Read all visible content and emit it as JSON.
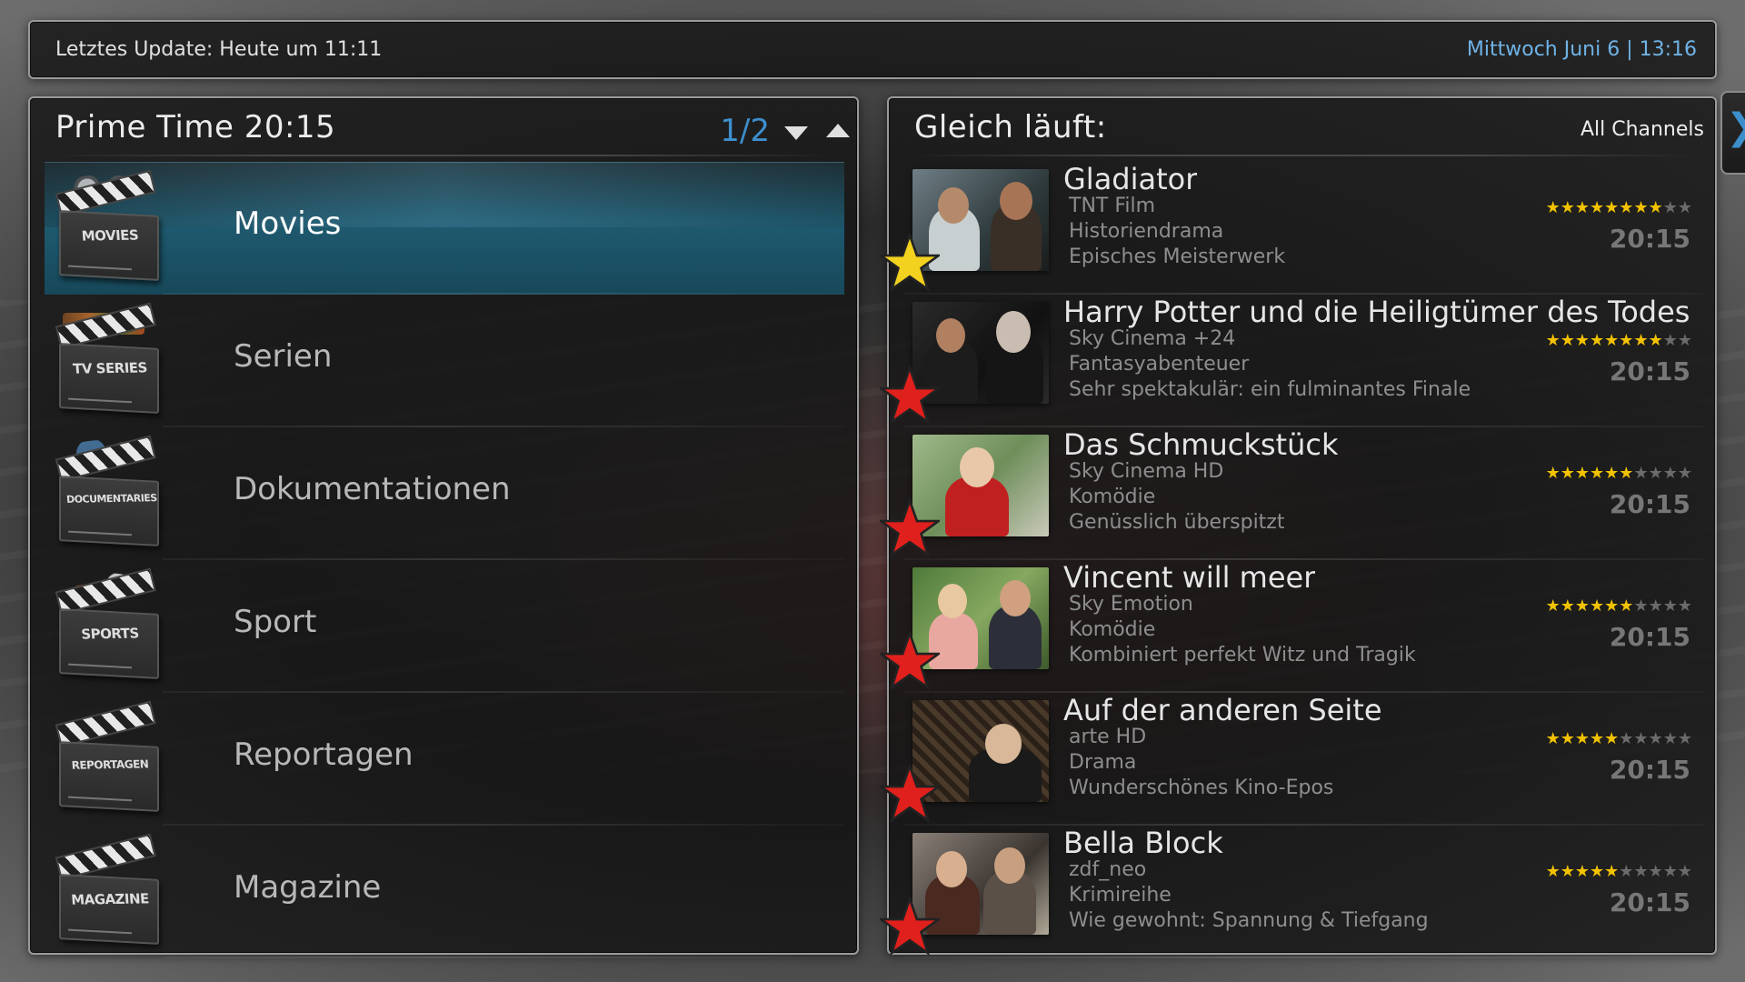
{
  "status_bar": {
    "last_update": "Letztes Update: Heute um 11:11",
    "datetime": "Mittwoch Juni 6 | 13:16"
  },
  "left_panel": {
    "title": "Prime Time 20:15",
    "pager": "1/2",
    "pager_down_icon": "triangle-down-icon",
    "pager_up_icon": "triangle-up-icon",
    "categories": [
      {
        "label": "Movies",
        "icon": "movies-clapperboard-icon",
        "icon_text": "MOVIES",
        "selected": true
      },
      {
        "label": "Serien",
        "icon": "tv-series-clapperboard-icon",
        "icon_text": "TV SERIES",
        "selected": false
      },
      {
        "label": "Dokumentationen",
        "icon": "documentaries-clapperboard-icon",
        "icon_text": "DOCUMENTARIES",
        "selected": false
      },
      {
        "label": "Sport",
        "icon": "sports-clapperboard-icon",
        "icon_text": "SPORTS",
        "selected": false
      },
      {
        "label": "Reportagen",
        "icon": "reportagen-clapperboard-icon",
        "icon_text": "REPORTAGEN",
        "selected": false
      },
      {
        "label": "Magazine",
        "icon": "magazine-clapperboard-icon",
        "icon_text": "MAGAZINE",
        "selected": false
      }
    ]
  },
  "right_panel": {
    "title": "Gleich läuft:",
    "channel_filter": "All Channels",
    "side_tab_icon": "chevron-right-icon",
    "shows": [
      {
        "title": "Gladiator",
        "channel": "TNT Film",
        "genre": "Historiendrama",
        "tagline": "Episches Meisterwerk",
        "rating": 8,
        "rating_max": 10,
        "time": "20:15",
        "favorite": true,
        "star_color": "#f2d21e"
      },
      {
        "title": "Harry Potter und die Heiligtümer des Todes (T",
        "channel": "Sky Cinema +24",
        "genre": "Fantasyabenteuer",
        "tagline": "Sehr spektakulär: ein fulminantes Finale",
        "rating": 8,
        "rating_max": 10,
        "time": "20:15",
        "favorite": false,
        "star_color": "#e0201c"
      },
      {
        "title": "Das Schmuckstück",
        "channel": "Sky Cinema HD",
        "genre": "Komödie",
        "tagline": "Genüsslich überspitzt",
        "rating": 6,
        "rating_max": 10,
        "time": "20:15",
        "favorite": false,
        "star_color": "#e0201c"
      },
      {
        "title": "Vincent will meer",
        "channel": "Sky Emotion",
        "genre": "Komödie",
        "tagline": "Kombiniert perfekt Witz und Tragik",
        "rating": 6,
        "rating_max": 10,
        "time": "20:15",
        "favorite": false,
        "star_color": "#e0201c"
      },
      {
        "title": "Auf der anderen Seite",
        "channel": "arte HD",
        "genre": "Drama",
        "tagline": "Wunderschönes Kino-Epos",
        "rating": 5,
        "rating_max": 10,
        "time": "20:15",
        "favorite": false,
        "star_color": "#e0201c"
      },
      {
        "title": "Bella Block",
        "channel": "zdf_neo",
        "genre": "Krimireihe",
        "tagline": "Wie gewohnt: Spannung & Tiefgang",
        "rating": 5,
        "rating_max": 10,
        "time": "20:15",
        "favorite": false,
        "star_color": "#e0201c"
      }
    ]
  },
  "colors": {
    "accent_blue": "#3d8fcc",
    "datetime_blue": "#6fb3e6",
    "rating_star": "#f2c200",
    "selected_row": "#1f5a70"
  }
}
